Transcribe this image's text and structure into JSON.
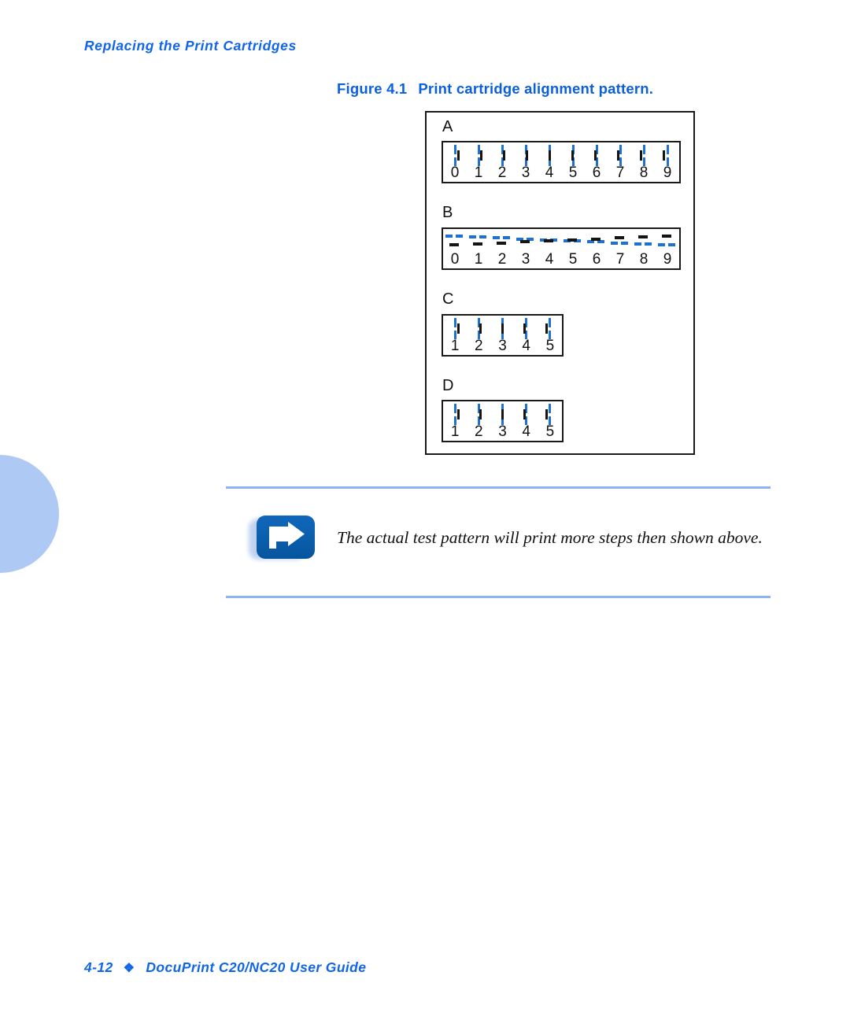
{
  "page": {
    "running_header": "Replacing the Print Cartridges",
    "background": "#ffffff",
    "accent_blue": "#1165e8",
    "pattern_blue": "#1d72d1",
    "rule_blue": "#8cb4f5",
    "tab_blue": "#afc9f5"
  },
  "figure": {
    "caption_number": "Figure 4.1",
    "caption_text": "Print cartridge alignment pattern.",
    "groups": [
      {
        "letter": "A",
        "orientation": "vertical",
        "labels": [
          "0",
          "1",
          "2",
          "3",
          "4",
          "5",
          "6",
          "7",
          "8",
          "9"
        ]
      },
      {
        "letter": "B",
        "orientation": "horizontal",
        "labels": [
          "0",
          "1",
          "2",
          "3",
          "4",
          "5",
          "6",
          "7",
          "8",
          "9"
        ]
      },
      {
        "letter": "C",
        "orientation": "vertical",
        "labels": [
          "1",
          "2",
          "3",
          "4",
          "5"
        ]
      },
      {
        "letter": "D",
        "orientation": "vertical",
        "labels": [
          "1",
          "2",
          "3",
          "4",
          "5"
        ]
      }
    ]
  },
  "note": {
    "icon": "arrow-right-note-icon",
    "text": "The actual test pattern will print more steps then shown above."
  },
  "footer": {
    "page_number": "4-12",
    "separator": "❖",
    "document_title": "DocuPrint C20/NC20 User Guide"
  }
}
